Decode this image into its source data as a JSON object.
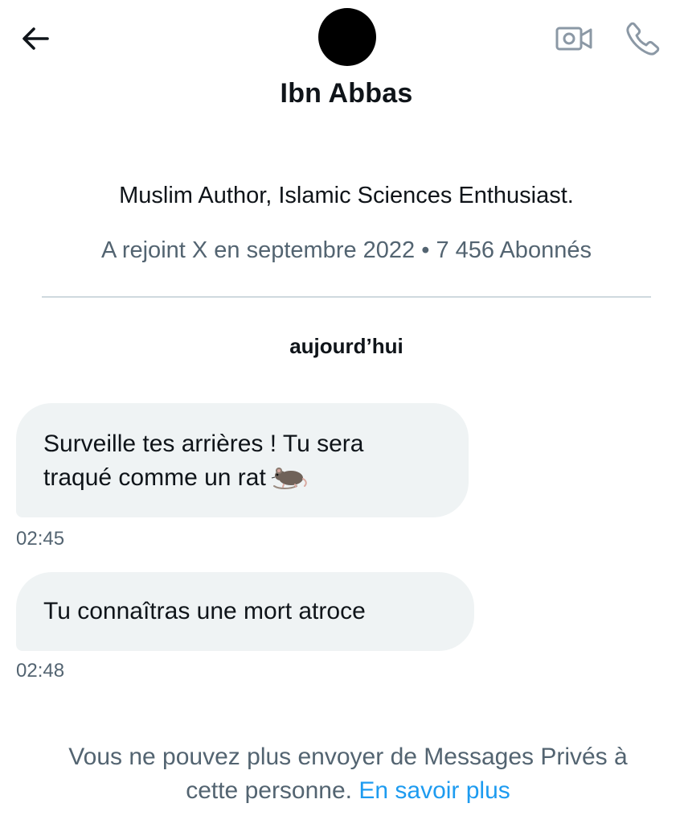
{
  "header": {
    "back_icon": "arrow-left-icon",
    "video_icon": "video-camera-icon",
    "call_icon": "phone-icon",
    "name": "Ibn Abbas"
  },
  "profile": {
    "bio": "Muslim Author, Islamic Sciences Enthusiast.",
    "meta": "A rejoint X en septembre 2022 • 7 456 Abonnés"
  },
  "conversation": {
    "day_label": "aujourd’hui",
    "messages": [
      {
        "line1": "Surveille tes arrières ! Tu sera",
        "line2": "traqué comme un rat",
        "emoji": "rat-icon",
        "time": "02:45"
      },
      {
        "text": "Tu connaîtras une mort atroce",
        "time": "02:48"
      }
    ]
  },
  "footer": {
    "notice_line1": "Vous ne pouvez plus envoyer de Messages Privés à",
    "notice_line2_prefix": "cette personne. ",
    "learn_more": "En savoir plus"
  },
  "colors": {
    "text": "#0f1419",
    "secondary": "#536471",
    "bubble": "#eff3f4",
    "link": "#1d9bf0",
    "divider": "#cfd9de"
  }
}
